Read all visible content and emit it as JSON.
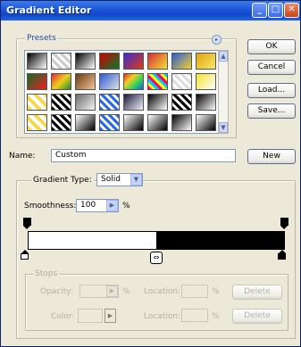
{
  "window": {
    "title": "Gradient Editor"
  },
  "presets": {
    "label": "Presets",
    "swatches": [
      [
        "linear-gradient(135deg,#000,#fff)",
        "repeating-linear-gradient(45deg,#ccc 0 3px,#fff 3px 6px)",
        "linear-gradient(135deg,#000,#fff)",
        "linear-gradient(135deg,#c00,#0a7a2a)",
        "linear-gradient(135deg,#3a2bd6,#e13b10)",
        "linear-gradient(135deg,#d62a3a,#f4e22e)",
        "linear-gradient(135deg,#2a5ad6,#f4d02e)",
        "linear-gradient(135deg,#e0a410,#f8e86a)"
      ],
      [
        "linear-gradient(135deg,#1a6a2a,#e62020)",
        "linear-gradient(135deg,#e22a2a,#f0d020,#2a8a2a)",
        "linear-gradient(135deg,#6a3a10,#f2c49a)",
        "linear-gradient(135deg,#2a5ad6,#e0e0e0)",
        "linear-gradient(135deg,#e22a2a,#f4d020,#2ad060,#2a5ad6)",
        "repeating-linear-gradient(45deg,#f06 0 3px,#ff0 3px 6px,#0cf 6px 9px)",
        "repeating-linear-gradient(45deg,#ddd 0 3px,#fff 3px 6px)",
        "linear-gradient(135deg,#f4e22e,#fff)"
      ],
      [
        "repeating-linear-gradient(45deg,#f6d84a 0 4px,#fff 4px 8px)",
        "repeating-linear-gradient(45deg,#000 0 3px,#fff 3px 6px)",
        "linear-gradient(135deg,#6a6a6a,#f4f4f4)",
        "repeating-linear-gradient(45deg,#2a6ae6 0 3px,#fff 3px 6px)",
        "linear-gradient(135deg,#1a1a3a,#f0f0ff)",
        "linear-gradient(135deg,#000,#fff)",
        "repeating-linear-gradient(45deg,#000 0 3px,#fff 3px 6px)",
        "linear-gradient(135deg,#000,#fff)"
      ],
      [
        "repeating-linear-gradient(45deg,#f6d84a 0 4px,#fff 4px 8px)",
        "repeating-linear-gradient(45deg,#000 0 3px,#fff 3px 6px)",
        "linear-gradient(135deg,#fff,#000)",
        "repeating-linear-gradient(45deg,#2a6ae6 0 3px,#fff 3px 6px)",
        "linear-gradient(135deg,#fff,#000)",
        "linear-gradient(135deg,#fff,#000)",
        "linear-gradient(135deg,#000,#fff)",
        "linear-gradient(135deg,#fff,#000)"
      ]
    ]
  },
  "buttons": {
    "ok": "OK",
    "cancel": "Cancel",
    "load": "Load...",
    "save": "Save...",
    "new": "New"
  },
  "name": {
    "label": "Name:",
    "value": "Custom"
  },
  "gradient_type": {
    "label": "Gradient Type:",
    "value": "Solid"
  },
  "smoothness": {
    "label": "Smoothness:",
    "value": "100",
    "unit": "%"
  },
  "stops": {
    "label": "Stops",
    "opacity_label": "Opacity:",
    "opacity_unit": "%",
    "location_label": "Location:",
    "location_unit": "%",
    "color_label": "Color:",
    "delete": "Delete"
  },
  "gradient": {
    "color_left": "#ffffff",
    "color_right": "#000000",
    "split": 0.5
  }
}
